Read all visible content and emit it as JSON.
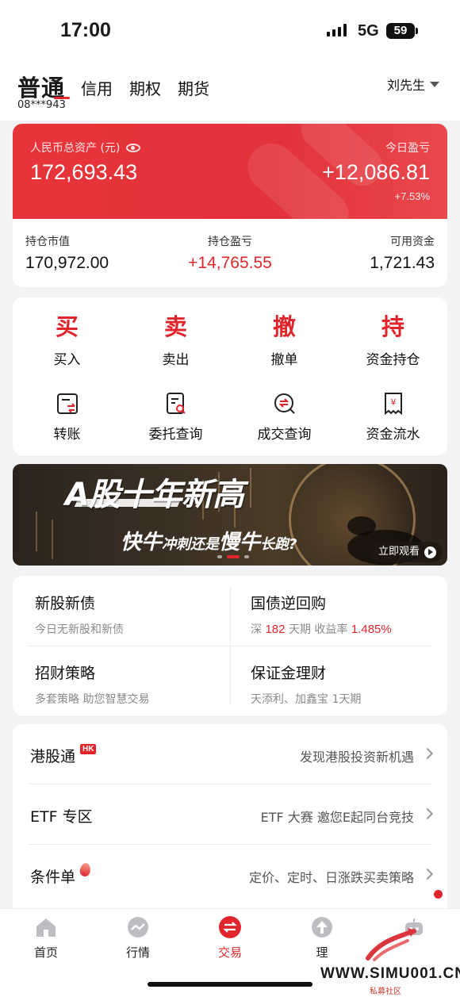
{
  "status": {
    "time": "17:00",
    "network": "5G",
    "battery": "59"
  },
  "header": {
    "account_tab": "普通",
    "account_no": "08***943",
    "tabs": [
      "信用",
      "期权",
      "期货"
    ],
    "user": "刘先生"
  },
  "asset": {
    "total_label": "人民币总资产 (元)",
    "total_value": "172,693.43",
    "today_pl_label": "今日盈亏",
    "today_pl_value": "+12,086.81",
    "today_pl_pct": "+7.53%",
    "market_value_label": "持仓市值",
    "market_value": "170,972.00",
    "position_pl_label": "持仓盈亏",
    "position_pl": "+14,765.55",
    "available_label": "可用资金",
    "available": "1,721.43"
  },
  "actions": [
    {
      "glyph": "买",
      "label": "买入"
    },
    {
      "glyph": "卖",
      "label": "卖出"
    },
    {
      "glyph": "撤",
      "label": "撤单"
    },
    {
      "glyph": "持",
      "label": "资金持仓"
    },
    {
      "icon": "transfer-icon",
      "label": "转账"
    },
    {
      "icon": "order-query-icon",
      "label": "委托查询"
    },
    {
      "icon": "deal-query-icon",
      "label": "成交查询"
    },
    {
      "icon": "cash-flow-icon",
      "label": "资金流水"
    }
  ],
  "banner": {
    "title": "A股十年新高",
    "subtitle_a": "快牛",
    "subtitle_b": "冲刺还是",
    "subtitle_c": "慢牛",
    "subtitle_d": "长跑?",
    "button": "立即观看"
  },
  "features": {
    "ipo": {
      "title": "新股新债",
      "sub": "今日无新股和新债"
    },
    "repo": {
      "title": "国债逆回购",
      "sub_a": "深",
      "sub_days": "182",
      "sub_b": "天期 收益率",
      "sub_rate": "1.485%"
    },
    "strategy": {
      "title": "招财策略",
      "sub": "多套策略 助您智慧交易"
    },
    "margin": {
      "title": "保证金理财",
      "sub": "天添利、加鑫宝 1天期"
    }
  },
  "list": [
    {
      "title": "港股通",
      "badge": "HK",
      "desc": "发现港股投资新机遇"
    },
    {
      "title": "ETF 专区",
      "desc": "ETF 大赛 邀您E起同台竞技"
    },
    {
      "title": "条件单",
      "desc": "定价、定时、日涨跌买卖策略"
    }
  ],
  "tabbar": [
    {
      "label": "首页",
      "icon": "home-icon"
    },
    {
      "label": "行情",
      "icon": "market-icon"
    },
    {
      "label": "交易",
      "icon": "trade-icon"
    },
    {
      "label": "理",
      "icon": "finance-icon"
    },
    {
      "label": "",
      "icon": "robot-icon"
    }
  ],
  "watermark": {
    "text": "WWW.SIMU001.CN",
    "sub": "私募社区"
  },
  "colors": {
    "accent": "#e0262c",
    "background": "#f3f3f5"
  }
}
